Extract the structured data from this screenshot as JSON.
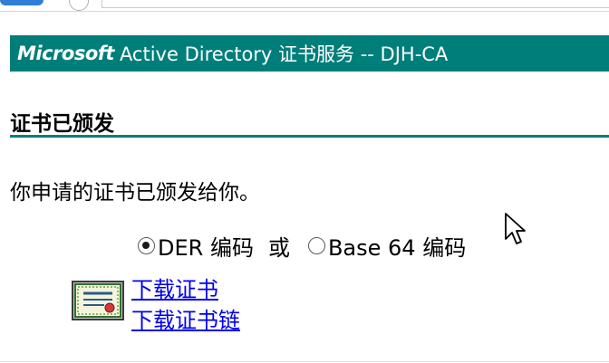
{
  "header": {
    "brand": "Microsoft",
    "title": "Active Directory 证书服务  --  DJH-CA"
  },
  "section": {
    "title": "证书已颁发"
  },
  "message": "你申请的证书已颁发给你。",
  "encoding": {
    "selected": "DER 编码",
    "options": [
      {
        "label": "DER 编码",
        "checked": true
      },
      {
        "label": "Base 64 编码",
        "checked": false
      }
    ],
    "separator": "或"
  },
  "links": {
    "download_cert": "下载证书",
    "download_chain": "下载证书链"
  },
  "colors": {
    "accent": "#007e7a",
    "link": "#0000ee"
  },
  "icons": {
    "certificate": "certificate-icon",
    "cursor": "mouse-cursor-icon"
  }
}
